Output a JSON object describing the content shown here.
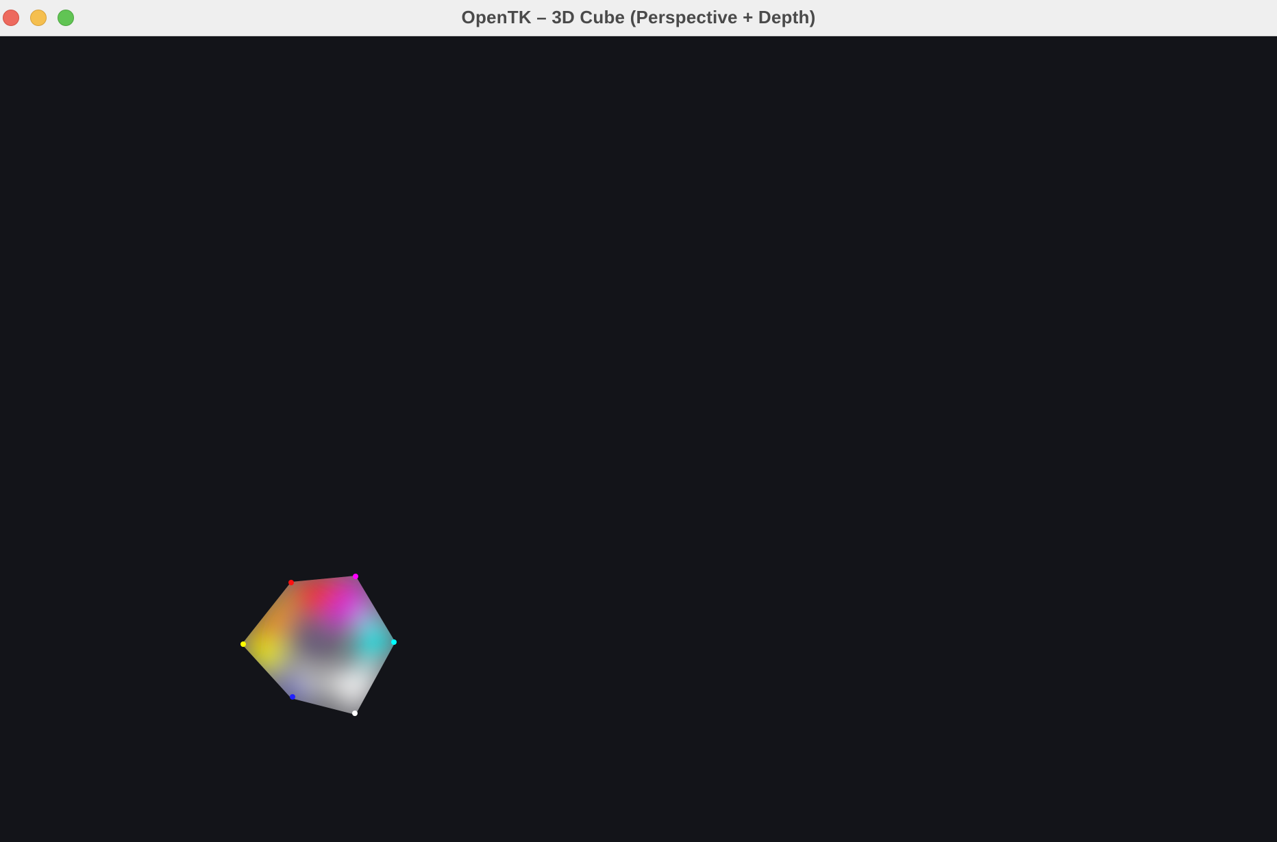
{
  "window": {
    "title": "OpenTK – 3D Cube (Perspective + Depth)",
    "background": "#131419"
  },
  "titlebar": {
    "close_color": "#ed6a5e",
    "minimize_color": "#f5bf4f",
    "zoom_color": "#61c454"
  },
  "scene": {
    "object": "cube",
    "corner_colors": {
      "red": "#ff0000",
      "magenta": "#ff00ff",
      "yellow": "#ffff00",
      "cyan": "#00ffff",
      "blue": "#0000ff",
      "white": "#ffffff",
      "center_grey": "#7a7a7a"
    }
  }
}
